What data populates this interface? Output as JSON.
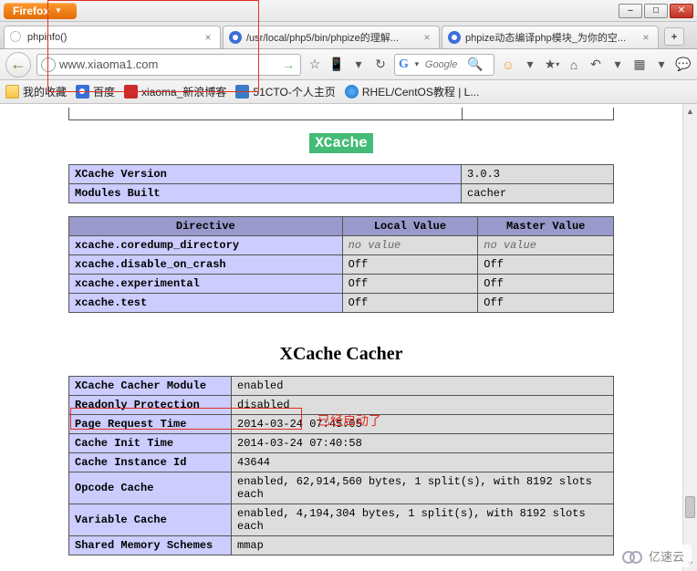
{
  "browser": {
    "name": "Firefox",
    "window_controls": {
      "min": "–",
      "max": "□",
      "close": "✕"
    }
  },
  "tabs": [
    {
      "title": "phpinfo()",
      "active": true,
      "favicon": "loading"
    },
    {
      "title": "/usr/local/php5/bin/phpize的理解...",
      "active": false,
      "favicon": "baidu"
    },
    {
      "title": "phpize动态编译php模块_为你的空...",
      "active": false,
      "favicon": "baidu"
    }
  ],
  "newtab_label": "+",
  "url": "www.xiaoma1.com",
  "toolbar": {
    "back": "←",
    "go": "→",
    "star": "☆",
    "mobile": "📱",
    "dropdown": "▾",
    "reload": "↻",
    "search_placeholder": "Google",
    "magnify": "🔍",
    "smiley": "☺",
    "bookmenu": "▾",
    "home": "⌂",
    "undo": "↶",
    "grid": "▦",
    "feedback": "💬"
  },
  "bookmarks": [
    {
      "label": "我的收藏",
      "icon": "folder"
    },
    {
      "label": "百度",
      "icon": "baidu"
    },
    {
      "label": "xiaoma_新浪博客",
      "icon": "red"
    },
    {
      "label": "51CTO-个人主页",
      "icon": "blue"
    },
    {
      "label": "RHEL/CentOS教程 | L...",
      "icon": "round"
    }
  ],
  "phpinfo": {
    "xcache_badge": "XCache",
    "table1": [
      {
        "k": "XCache Version",
        "v": "3.0.3"
      },
      {
        "k": "Modules Built",
        "v": "cacher"
      }
    ],
    "table2_headers": [
      "Directive",
      "Local Value",
      "Master Value"
    ],
    "table2_rows": [
      {
        "d": "xcache.coredump_directory",
        "l": "no value",
        "m": "no value",
        "italic": true
      },
      {
        "d": "xcache.disable_on_crash",
        "l": "Off",
        "m": "Off"
      },
      {
        "d": "xcache.experimental",
        "l": "Off",
        "m": "Off"
      },
      {
        "d": "xcache.test",
        "l": "Off",
        "m": "Off"
      }
    ],
    "cacher_title": "XCache Cacher",
    "table3": [
      {
        "k": "XCache Cacher Module",
        "v": "enabled"
      },
      {
        "k": "Readonly Protection",
        "v": "disabled"
      },
      {
        "k": "Page Request Time",
        "v": "2014-03-24 07:45:05"
      },
      {
        "k": "Cache Init Time",
        "v": "2014-03-24 07:40:58"
      },
      {
        "k": "Cache Instance Id",
        "v": "43644"
      },
      {
        "k": "Opcode Cache",
        "v": "enabled, 62,914,560 bytes, 1 split(s), with 8192 slots each"
      },
      {
        "k": "Variable Cache",
        "v": "enabled, 4,194,304 bytes, 1 split(s), with 8192 slots each"
      },
      {
        "k": "Shared Memory Schemes",
        "v": "mmap"
      }
    ]
  },
  "annotation": {
    "text": "已经启动了"
  },
  "watermark": "亿速云"
}
